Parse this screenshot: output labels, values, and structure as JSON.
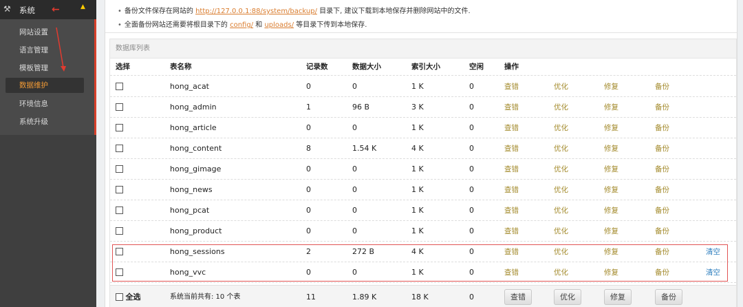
{
  "sidebar": {
    "section_title": "系统",
    "items": [
      {
        "label": "网站设置"
      },
      {
        "label": "语言管理"
      },
      {
        "label": "模板管理"
      },
      {
        "label": "数据维护"
      },
      {
        "label": "环境信息"
      },
      {
        "label": "系统升级"
      }
    ],
    "active_item": "数据维护"
  },
  "tips": {
    "line1_a": "备份文件保存在网站的",
    "line1_link": "http://127.0.0.1:88/system/backup/",
    "line1_b": "目录下, 建议下载到本地保存并删除网站中的文件.",
    "line2_a": "全面备份网站还需要将根目录下的",
    "line2_link1": "config/",
    "line2_mid": "和",
    "line2_link2": "uploads/",
    "line2_b": "等目录下传到本地保存."
  },
  "panel": {
    "title": "数据库列表",
    "headers": [
      "选择",
      "表名称",
      "记录数",
      "数据大小",
      "索引大小",
      "空闲",
      "操作"
    ],
    "actions": [
      "查错",
      "优化",
      "修复",
      "备份",
      "清空"
    ],
    "rows": [
      {
        "name": "hong_acat",
        "records": "0",
        "data_size": "0",
        "index_size": "1 K",
        "free": "0",
        "clearable": false
      },
      {
        "name": "hong_admin",
        "records": "1",
        "data_size": "96 B",
        "index_size": "3 K",
        "free": "0",
        "clearable": false
      },
      {
        "name": "hong_article",
        "records": "0",
        "data_size": "0",
        "index_size": "1 K",
        "free": "0",
        "clearable": false
      },
      {
        "name": "hong_content",
        "records": "8",
        "data_size": "1.54 K",
        "index_size": "4 K",
        "free": "0",
        "clearable": false
      },
      {
        "name": "hong_gimage",
        "records": "0",
        "data_size": "0",
        "index_size": "1 K",
        "free": "0",
        "clearable": false
      },
      {
        "name": "hong_news",
        "records": "0",
        "data_size": "0",
        "index_size": "1 K",
        "free": "0",
        "clearable": false
      },
      {
        "name": "hong_pcat",
        "records": "0",
        "data_size": "0",
        "index_size": "1 K",
        "free": "0",
        "clearable": false
      },
      {
        "name": "hong_product",
        "records": "0",
        "data_size": "0",
        "index_size": "1 K",
        "free": "0",
        "clearable": false
      },
      {
        "name": "hong_sessions",
        "records": "2",
        "data_size": "272 B",
        "index_size": "4 K",
        "free": "0",
        "clearable": true
      },
      {
        "name": "hong_vvc",
        "records": "0",
        "data_size": "0",
        "index_size": "1 K",
        "free": "0",
        "clearable": true
      }
    ],
    "footer": {
      "select_all": "全选",
      "summary": "系统当前共有: 10 个表",
      "total_records": "11",
      "total_data": "1.89 K",
      "total_index": "18 K",
      "total_free": "0",
      "buttons": [
        "查错",
        "优化",
        "修复",
        "备份"
      ]
    }
  },
  "colors": {
    "accent": "#f19a35",
    "action_text": "#a38a2b",
    "clear_link": "#2f7fbf",
    "annotation_red": "#e15353"
  }
}
